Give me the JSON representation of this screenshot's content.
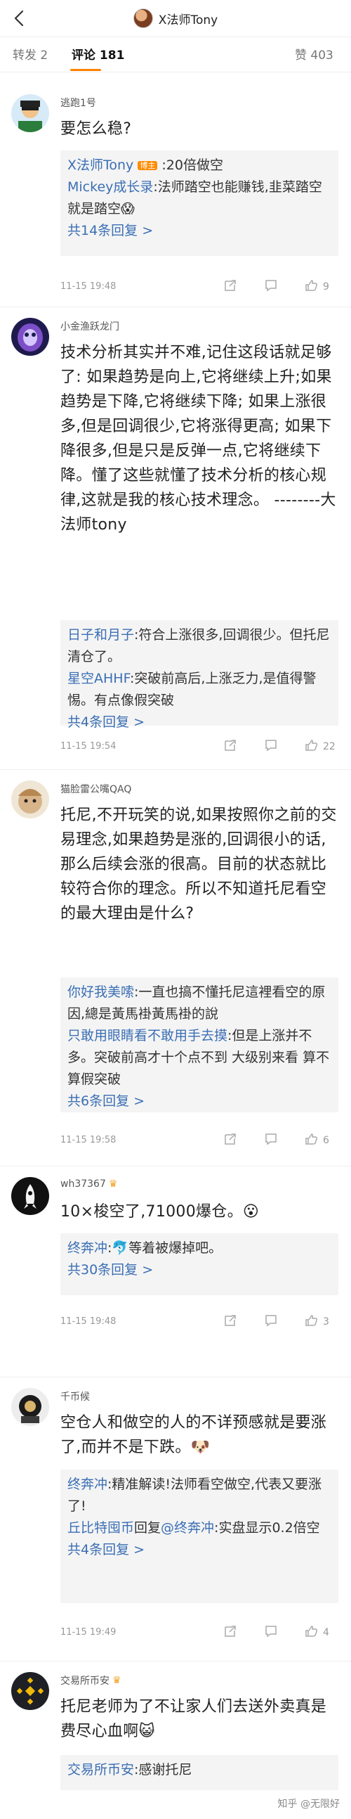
{
  "header": {
    "title": "X法师Tony",
    "back_icon": "back-arrow-icon"
  },
  "tabs": [
    {
      "label": "转发 2"
    },
    {
      "label": "评论 181"
    },
    {
      "label": "赞 403"
    }
  ],
  "comments": [
    {
      "user": "逃跑1号",
      "text": "要怎么稳?",
      "replies": [
        {
          "name": "X法师Tony",
          "badge": "博主",
          "text": ":20倍做空"
        },
        {
          "name": "Mickey成长录",
          "text": ":法师踏空也能赚钱,韭菜踏空就是踏空😱"
        }
      ],
      "more": "共14条回复 >",
      "time": "11-15 19:48",
      "likes": "9"
    },
    {
      "user": "小金渔跃龙门",
      "text": "技术分析其实并不难,记住这段话就足够了:  如果趋势是向上,它将继续上升;如果趋势是下降,它将继续下降;  如果上涨很多,但是回调很少,它将涨得更高;  如果下降很多,但是只是反弹一点,它将继续下降。懂了这些就懂了技术分析的核心规律,这就是我的核心技术理念。 --------大法师tony",
      "replies": [
        {
          "name": "日子和月子",
          "text": ":符合上涨很多,回调很少。但托尼清仓了。"
        },
        {
          "name": "星空AHHF",
          "text": ":突破前高后,上涨乏力,是值得警惕。有点像假突破"
        }
      ],
      "more": "共4条回复 >",
      "time": "11-15 19:54",
      "likes": "22"
    },
    {
      "user": "猫脸雷公嘴QAQ",
      "text": "托尼,不开玩笑的说,如果按照你之前的交易理念,如果趋势是涨的,回调很小的话,那么后续会涨的很高。目前的状态就比较符合你的理念。所以不知道托尼看空的最大理由是什么?",
      "replies": [
        {
          "name": "你好我美嗦",
          "text": ":一直也搞不懂托尼這裡看空的原因,總是黃馬褂黃馬褂的說"
        },
        {
          "name": "只敢用眼睛看不敢用手去摸",
          "text": ":但是上涨并不多。突破前高才十个点不到 大级别来看 算不算假突破"
        }
      ],
      "more": "共6条回复 >",
      "time": "11-15 19:58",
      "likes": "6"
    },
    {
      "user": "wh37367",
      "text": "10×梭空了,71000爆仓。😮",
      "replies": [
        {
          "name": "终奔冲",
          "text": ":🐬等着被爆掉吧。"
        }
      ],
      "more": "共30条回复 >",
      "time": "11-15 19:48",
      "likes": "3"
    },
    {
      "user": "千币候",
      "text": "空仓人和做空的人的不详预感就是要涨了,而并不是下跌。🐶",
      "replies": [
        {
          "name": "终奔冲",
          "text": ":精准解读!法师看空做空,代表又要涨了!"
        },
        {
          "name": "丘比特囤币",
          "mid": "回复",
          "name2": "@终奔冲",
          "text": ":实盘显示0.2倍空"
        }
      ],
      "more": "共4条回复 >",
      "time": "11-15 19:49",
      "likes": "4"
    },
    {
      "user": "交易所币安",
      "text": "托尼老师为了不让家人们去送外卖真是费尽心血啊😺",
      "replies": [
        {
          "name": "交易所币安",
          "text": ":感谢托尼"
        }
      ]
    }
  ],
  "watermark": "知乎 @无限好"
}
